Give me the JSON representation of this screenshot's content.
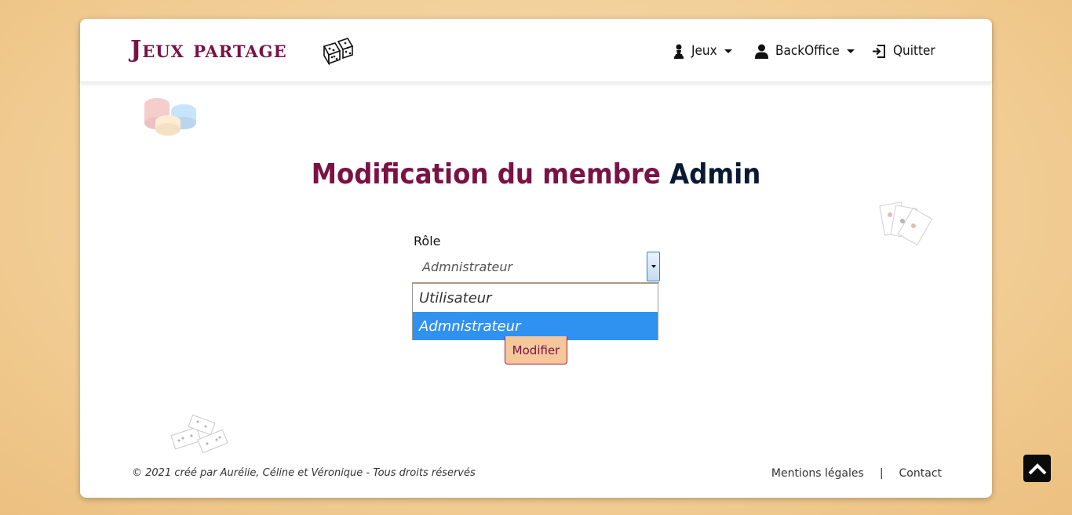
{
  "brand": {
    "name": "Jeux partage"
  },
  "nav": {
    "games_label": "Jeux",
    "backoffice_label": "BackOffice",
    "quit_label": "Quitter"
  },
  "page": {
    "title_prefix": "Modification du membre",
    "member_name": "Admin"
  },
  "form": {
    "role_label": "Rôle",
    "role_selected": "Admnistrateur",
    "role_options": [
      "Utilisateur",
      "Admnistrateur"
    ],
    "submit_label": "Modifier"
  },
  "footer": {
    "copyright": "© 2021 créé par Aurélie, Céline et Véronique - Tous droits réservés",
    "legal_label": "Mentions légales",
    "separator": "|",
    "contact_label": "Contact"
  },
  "colors": {
    "accent": "#7a1245",
    "highlight": "#3092f0",
    "button_bg": "#f5c79a"
  }
}
